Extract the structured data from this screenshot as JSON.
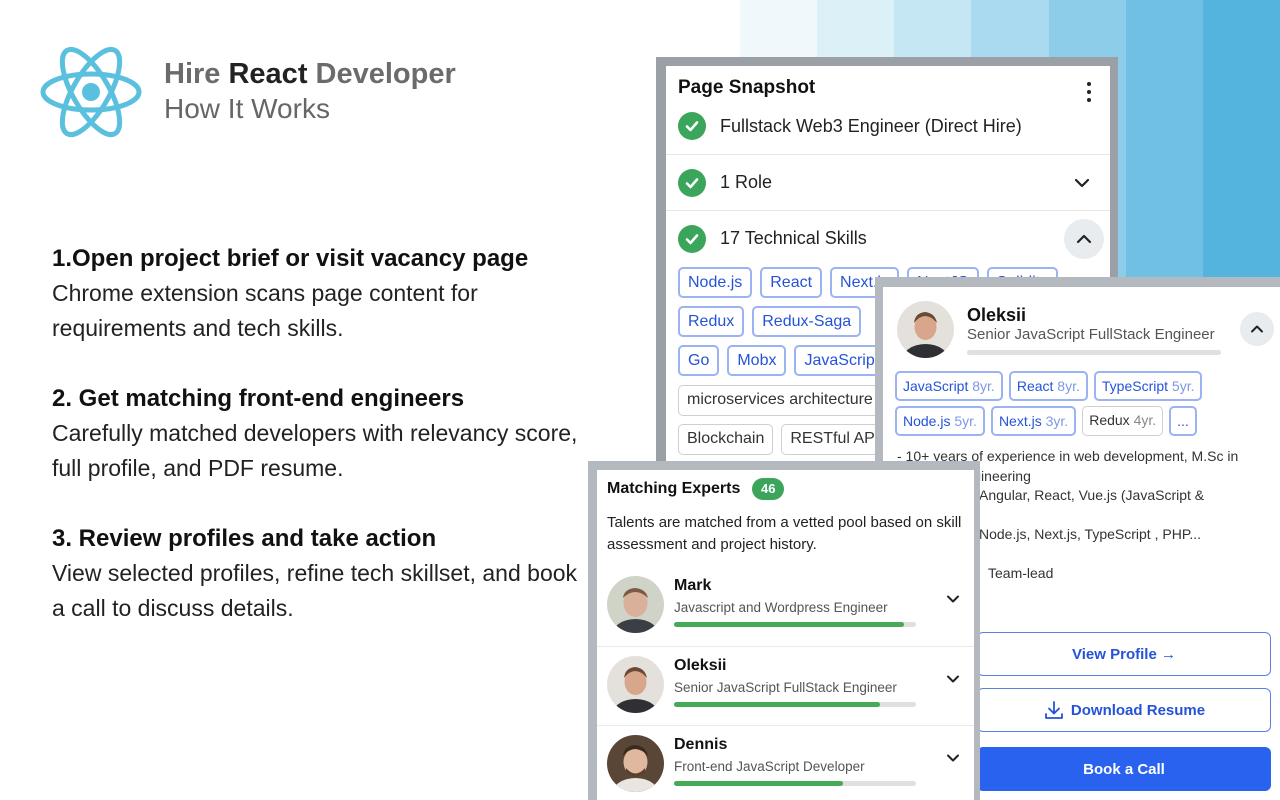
{
  "brand": {
    "title_prefix": "Hire ",
    "title_strong": "React",
    "title_suffix": " Developer",
    "subtitle": "How It Works",
    "logo_icon": "react-atom-icon",
    "logo_color": "#5bc0de"
  },
  "stripe_colors": [
    "#f0f8fc",
    "#dcf0f8",
    "#c5e6f3",
    "#a9daef",
    "#8dcde9",
    "#6fc0e3",
    "#55b4de"
  ],
  "steps": [
    {
      "title": "1.Open project brief or visit vacancy page",
      "body": "Chrome extension scans page content for requirements and tech skills."
    },
    {
      "title": "2. Get matching front-end engineers",
      "body": "Carefully matched developers with relevancy score,  full profile, and PDF resume."
    },
    {
      "title": "3. Review profiles and take action",
      "body": "View selected profiles, refine tech skillset, and book a call to discuss details."
    }
  ],
  "snapshot": {
    "title": "Page Snapshot",
    "rows": [
      {
        "label": "Fullstack Web3 Engineer (Direct Hire)"
      },
      {
        "label": "1 Role"
      },
      {
        "label": "17 Technical Skills"
      }
    ],
    "skills": [
      [
        "Node.js",
        "React",
        "Next.js",
        "NestJS",
        "Solidity"
      ],
      [
        "Redux",
        "Redux-Saga"
      ],
      [
        "Go",
        "Mobx",
        "JavaScript"
      ],
      [
        "microservices architecture"
      ],
      [
        "Blockchain",
        "RESTful API"
      ]
    ]
  },
  "profile": {
    "name": "Oleksii",
    "role": "Senior JavaScript FullStack Engineer",
    "skills_row1": [
      {
        "name": "JavaScript",
        "years": "8yr."
      },
      {
        "name": "React",
        "years": "8yr."
      },
      {
        "name": "TypeScript",
        "years": "5yr."
      }
    ],
    "skills_row2": [
      {
        "name": "Node.js",
        "years": "5yr."
      },
      {
        "name": "Next.js",
        "years": "3yr."
      },
      {
        "name": "Redux",
        "years": "4yr."
      }
    ],
    "more_label": "...",
    "summary_lines": [
      "- 10+ years of experience in web development, M.Sc in",
      "Software Engineering",
      "Angular, React, Vue.js (JavaScript &",
      "",
      "Node.js, Next.js, TypeScript , PHP...",
      "",
      "Team-lead"
    ],
    "view_profile": "View Profile →",
    "download_resume": "Download Resume",
    "book_call": "Book a Call"
  },
  "experts": {
    "title": "Matching Experts",
    "count": "46",
    "description": "Talents are matched from a vetted pool based on skill assessment and project history.",
    "list": [
      {
        "name": "Mark",
        "role": "Javascript and Wordpress Engineer",
        "score": 0.95
      },
      {
        "name": "Oleksii",
        "role": "Senior JavaScript FullStack Engineer",
        "score": 0.85
      },
      {
        "name": "Dennis",
        "role": "Front-end JavaScript Developer",
        "score": 0.7
      }
    ]
  },
  "colors": {
    "accent_blue": "#2962ef",
    "check_green": "#3ba55c",
    "chip_border": "#9bb3f3"
  }
}
